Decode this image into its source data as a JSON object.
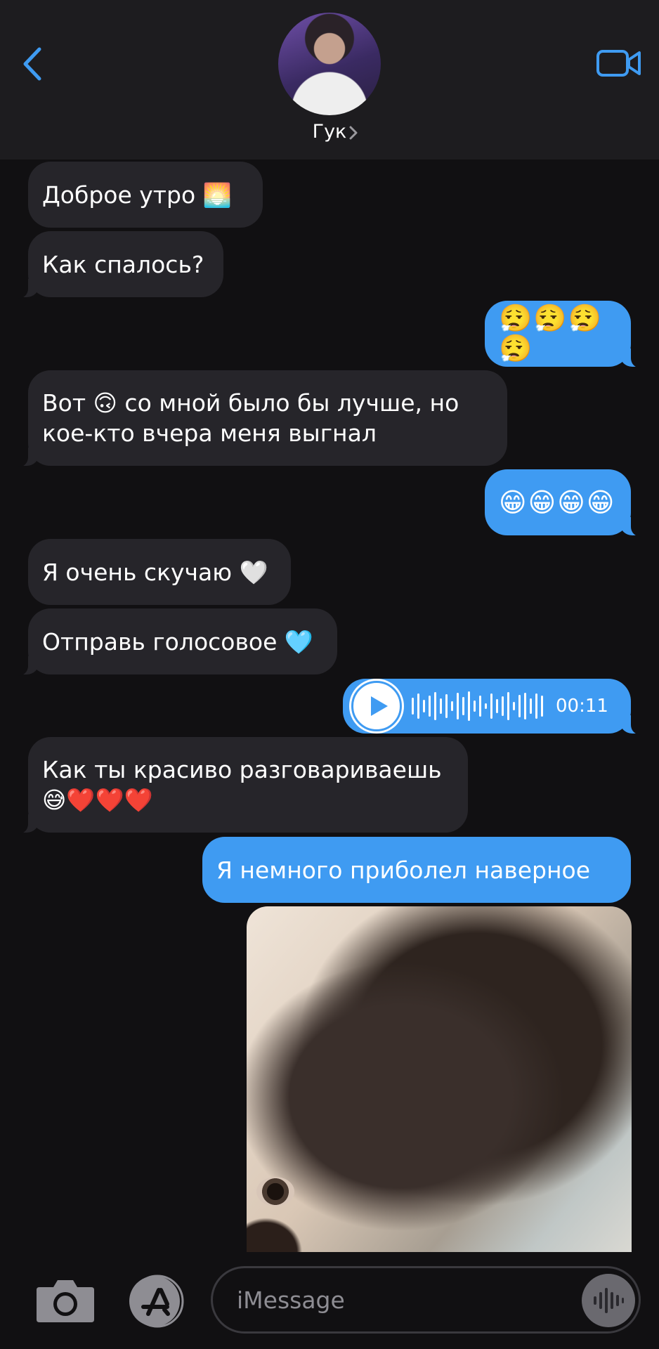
{
  "header": {
    "contact_name": "Гук"
  },
  "messages": [
    {
      "direction": "incoming",
      "text": "Доброе утро 🌅"
    },
    {
      "direction": "incoming",
      "text": "Как спалось?"
    },
    {
      "direction": "outgoing",
      "text": "😮‍💨😮‍💨😮‍💨😮‍💨"
    },
    {
      "direction": "incoming",
      "text": "Вот 🙃 со мной было бы лучше,  но кое-кто вчера  меня выгнал"
    },
    {
      "direction": "outgoing",
      "text": "😁😁😁😁"
    },
    {
      "direction": "incoming",
      "text": "Я очень скучаю 🤍"
    },
    {
      "direction": "incoming",
      "text": "Отправь голосовое 🩵"
    },
    {
      "direction": "outgoing",
      "type": "audio",
      "duration": "00:11"
    },
    {
      "direction": "incoming",
      "text": "Как ты красиво разговариваешь 😅❤️❤️❤️"
    },
    {
      "direction": "outgoing",
      "text": "Я немного приболел наверное"
    },
    {
      "direction": "outgoing",
      "type": "photo"
    }
  ],
  "composer": {
    "placeholder": "iMessage"
  },
  "colors": {
    "accent": "#3f9bf2",
    "incoming_bubble": "#26252a",
    "background": "#111012",
    "header": "#1d1c1f"
  }
}
